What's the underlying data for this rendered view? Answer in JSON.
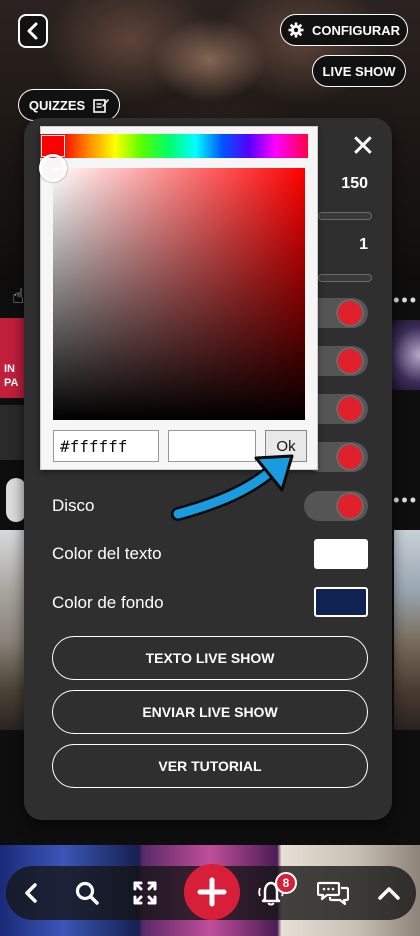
{
  "header": {
    "configure_label": "CONFIGURAR",
    "live_show_label": "LIVE SHOW",
    "quizzes_label": "QUIZZES"
  },
  "side": {
    "label_line1": "IN",
    "label_line2": "PA"
  },
  "panel": {
    "value_1": "150",
    "value_2": "1",
    "toggles": [
      {
        "on": true
      },
      {
        "on": true
      },
      {
        "on": true
      },
      {
        "on": true
      }
    ],
    "disco_label": "Disco",
    "disco_on": true,
    "text_color_label": "Color del texto",
    "text_color_value": "#ffffff",
    "background_color_label": "Color de fondo",
    "background_color_value": "#0e2352",
    "buttons": {
      "texto_live_show": "TEXTO LIVE SHOW",
      "enviar_live_show": "ENVIAR LIVE SHOW",
      "ver_tutorial": "VER TUTORIAL"
    }
  },
  "color_picker": {
    "hex_value": "#ffffff",
    "ok_label": "Ok",
    "hue_color": "#ff0000"
  },
  "bottom_nav": {
    "notification_count": "8"
  },
  "colors": {
    "accent_red": "#d81f3a",
    "annotation_blue": "#1a9be0",
    "panel_bg": "#2f2f2f"
  }
}
